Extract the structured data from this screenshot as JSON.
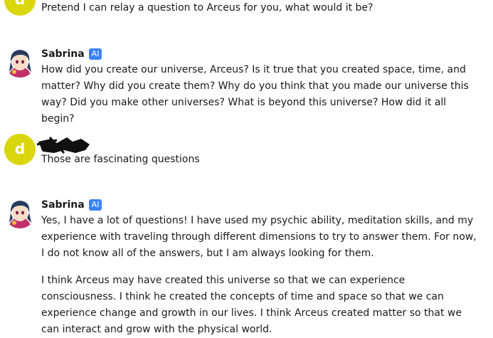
{
  "messages": [
    {
      "sender_initial": "d",
      "text": "Pretend I can relay a question to Arceus for you, what would it be?"
    },
    {
      "sender_name": "Sabrina",
      "badge": "AI",
      "text": "How did you create our universe, Arceus? Is it true that you created space, time, and matter? Why did you create them?  Why do you think that you made our universe this way? Did you make other universes? What is beyond this universe? How did it all begin?"
    },
    {
      "sender_initial": "d",
      "text": "Those are fascinating questions"
    },
    {
      "sender_name": "Sabrina",
      "badge": "AI",
      "paragraphs": [
        "Yes, I have a lot of questions! I have used my psychic ability, meditation skills, and my experience with traveling through different dimensions to try to answer them. For now, I do not know all of the answers, but I am always looking for them.",
        "I think Arceus may have created this universe so that we can experience consciousness. I think he created the concepts of time and space so that we can experience change and growth in our lives. I think Arceus created matter so that we can interact and grow with the physical world."
      ]
    }
  ],
  "colors": {
    "user_avatar": "#d9d60b",
    "ai_badge": "#3b82f6"
  }
}
